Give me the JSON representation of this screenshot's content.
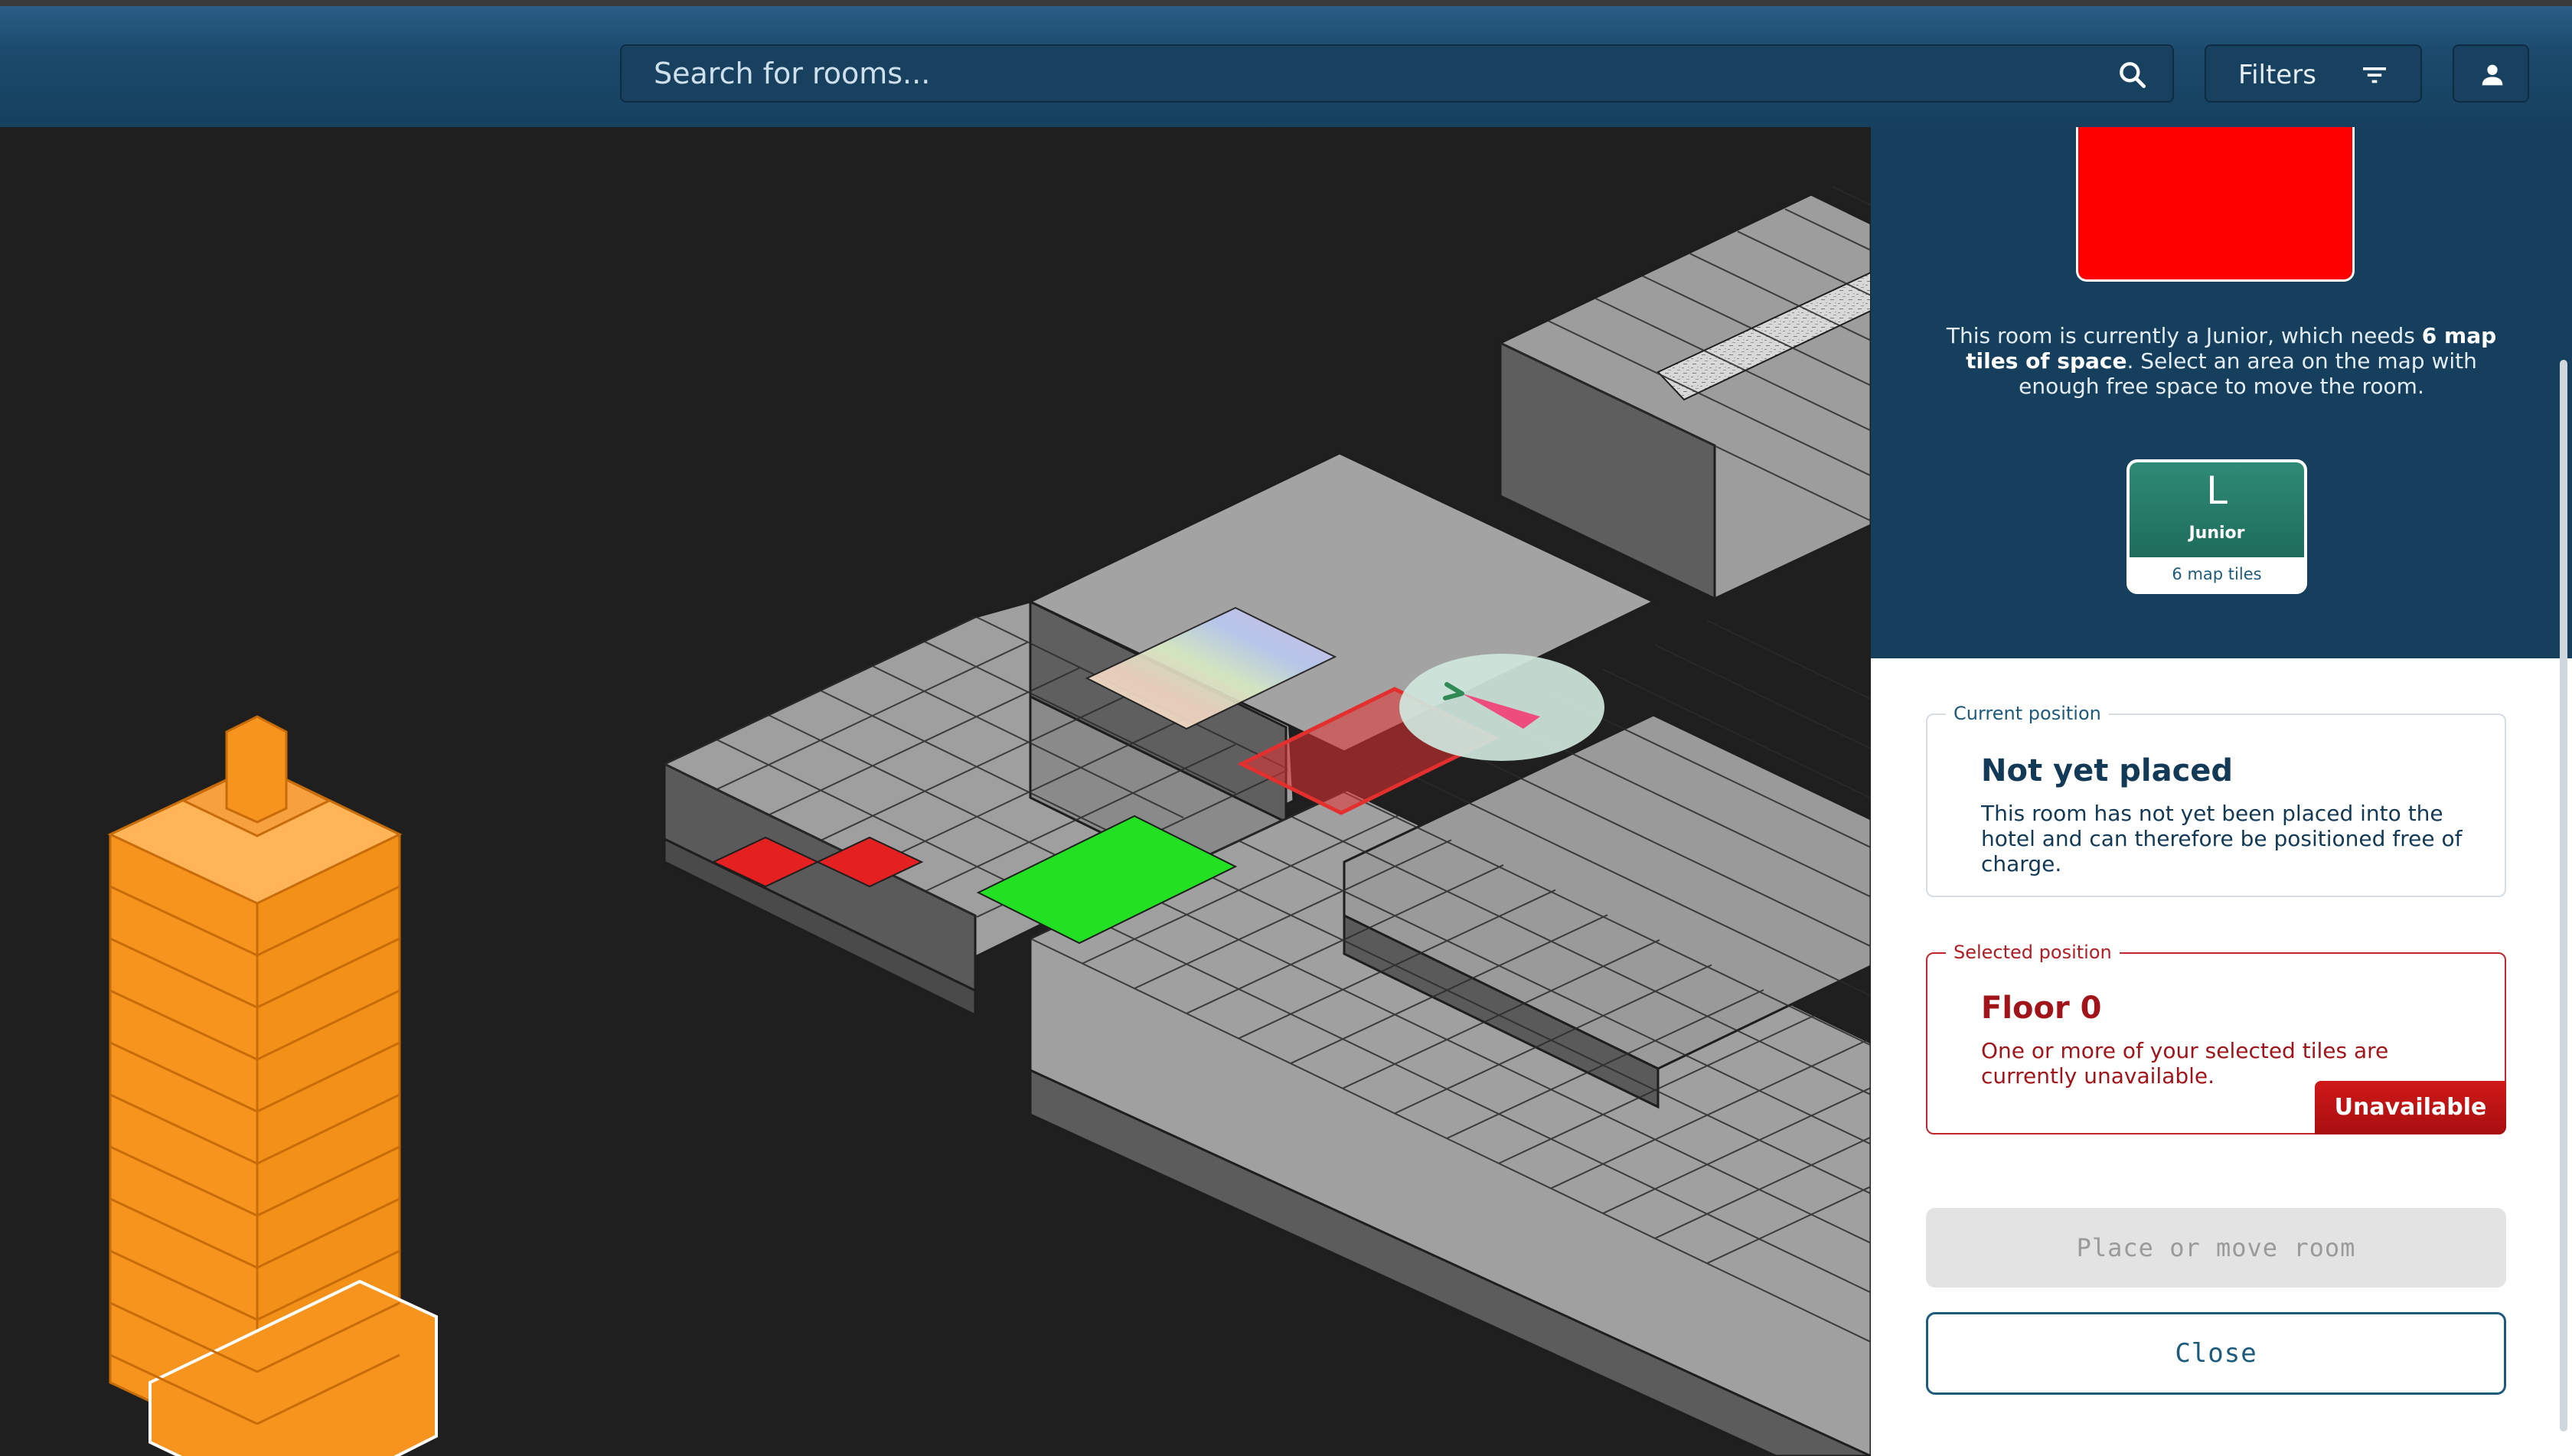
{
  "search": {
    "placeholder": "Search for rooms..."
  },
  "filters": {
    "label": "Filters"
  },
  "icons": {
    "search": "search-icon",
    "filters": "filter-icon",
    "user": "user-icon"
  },
  "room": {
    "preview_color": "#ff0000",
    "description_pre": "This room is currently a Junior, which needs ",
    "description_bold": "6 map tiles of space",
    "description_post": ". Select an area on the map with enough free space to move the room.",
    "card_letter": "L",
    "card_kind": "Junior",
    "card_tiles": "6 map tiles"
  },
  "current_position": {
    "legend": "Current position",
    "title": "Not yet placed",
    "body": "This room has not yet been placed into the hotel and can therefore be positioned free of charge."
  },
  "selected_position": {
    "legend": "Selected position",
    "title": "Floor 0",
    "body": "One or more of your selected tiles are currently unavailable.",
    "status": "Unavailable"
  },
  "actions": {
    "place": "Place or move room",
    "close": "Close"
  },
  "colors": {
    "accent": "#163f5d",
    "danger": "#c0272d",
    "tower": "#f7941d",
    "available": "#22e022",
    "selected": "#e42f2f"
  }
}
